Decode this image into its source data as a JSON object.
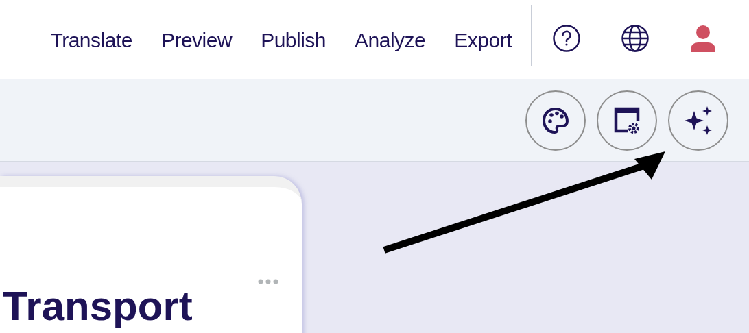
{
  "nav": {
    "links": [
      "Translate",
      "Preview",
      "Publish",
      "Analyze",
      "Export"
    ]
  },
  "card": {
    "title": "Transport"
  }
}
